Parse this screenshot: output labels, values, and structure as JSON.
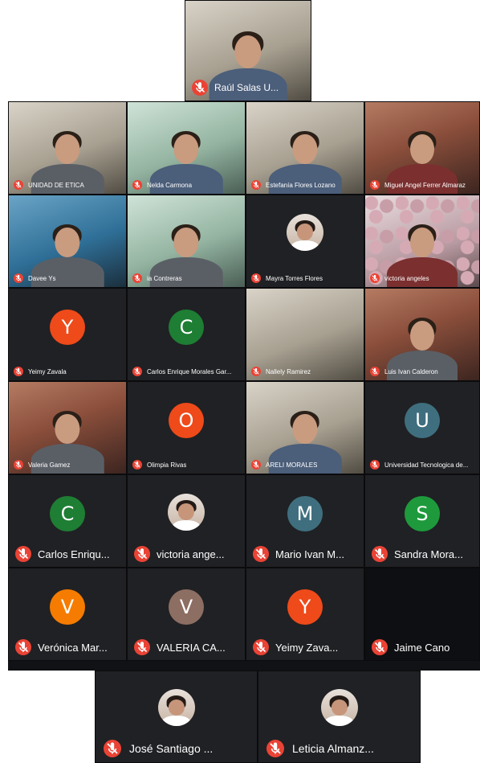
{
  "meeting": {
    "top_participant": {
      "name": "Raúl Salas U...",
      "video": "room"
    },
    "grid": {
      "rows": [
        [
          {
            "name": "UNIDAD DE ETICA",
            "tile": "video",
            "style": "room",
            "person": "gray"
          },
          {
            "name": "Nelda Carmona",
            "tile": "video",
            "style": "green",
            "person": "light"
          },
          {
            "name": "Estefanía Flores Lozano",
            "tile": "video",
            "style": "room",
            "person": "light"
          },
          {
            "name": "Miguel Angel Ferrer Almaraz",
            "tile": "video",
            "style": "warm",
            "person": "red"
          }
        ],
        [
          {
            "name": "Davee Ys",
            "tile": "video",
            "style": "blue",
            "person": "gray"
          },
          {
            "name": "ia Contreras",
            "tile": "video",
            "style": "green",
            "person": "gray"
          },
          {
            "name": "Mayra Torres Flores",
            "tile": "photo",
            "style": "dark"
          },
          {
            "name": "victoria angeles",
            "tile": "video",
            "style": "pattern",
            "person": "red"
          }
        ],
        [
          {
            "name": "Yeimy Zavala",
            "tile": "avatar",
            "initial": "Y",
            "color": "#ef4a1a"
          },
          {
            "name": "Carlos Enrique Morales Gar...",
            "tile": "avatar",
            "initial": "C",
            "color": "#1e7e34"
          },
          {
            "name": "Nallely Ramirez",
            "tile": "video",
            "style": "room",
            "person": "none"
          },
          {
            "name": "Luis Ivan Calderon",
            "tile": "video",
            "style": "warm",
            "person": "gray"
          }
        ],
        [
          {
            "name": "Valeria Gamez",
            "tile": "video",
            "style": "warm",
            "person": "gray"
          },
          {
            "name": "Olimpia Rivas",
            "tile": "avatar",
            "initial": "O",
            "color": "#ef4a1a"
          },
          {
            "name": "ARELI MORALES",
            "tile": "video",
            "style": "room",
            "person": "light"
          },
          {
            "name": "Universidad Tecnologica de...",
            "tile": "avatar",
            "initial": "U",
            "color": "#3f6f7f"
          }
        ],
        [
          {
            "name": "Carlos Enriqu...",
            "tile": "avatar",
            "initial": "C",
            "color": "#1e7e34",
            "label_size": "big"
          },
          {
            "name": "victoria ange...",
            "tile": "photo",
            "style": "dark",
            "label_size": "big"
          },
          {
            "name": "Mario Ivan M...",
            "tile": "avatar",
            "initial": "M",
            "color": "#3f6f7f",
            "label_size": "big"
          },
          {
            "name": "Sandra Mora...",
            "tile": "avatar",
            "initial": "S",
            "color": "#1e9a3c",
            "label_size": "big"
          }
        ],
        [
          {
            "name": "Verónica Mar...",
            "tile": "avatar",
            "initial": "V",
            "color": "#f57c00",
            "label_size": "big"
          },
          {
            "name": "VALERIA CA...",
            "tile": "avatar",
            "initial": "V",
            "color": "#8d6e63",
            "label_size": "big"
          },
          {
            "name": "Yeimy Zava...",
            "tile": "avatar",
            "initial": "Y",
            "color": "#ef4a1a",
            "label_size": "big"
          },
          {
            "name": "Jaime Cano",
            "tile": "none",
            "label_size": "big"
          }
        ]
      ]
    },
    "bottom": [
      {
        "name": "José Santiago ...",
        "tile": "photo"
      },
      {
        "name": "Leticia Almanz...",
        "tile": "photo"
      }
    ]
  }
}
